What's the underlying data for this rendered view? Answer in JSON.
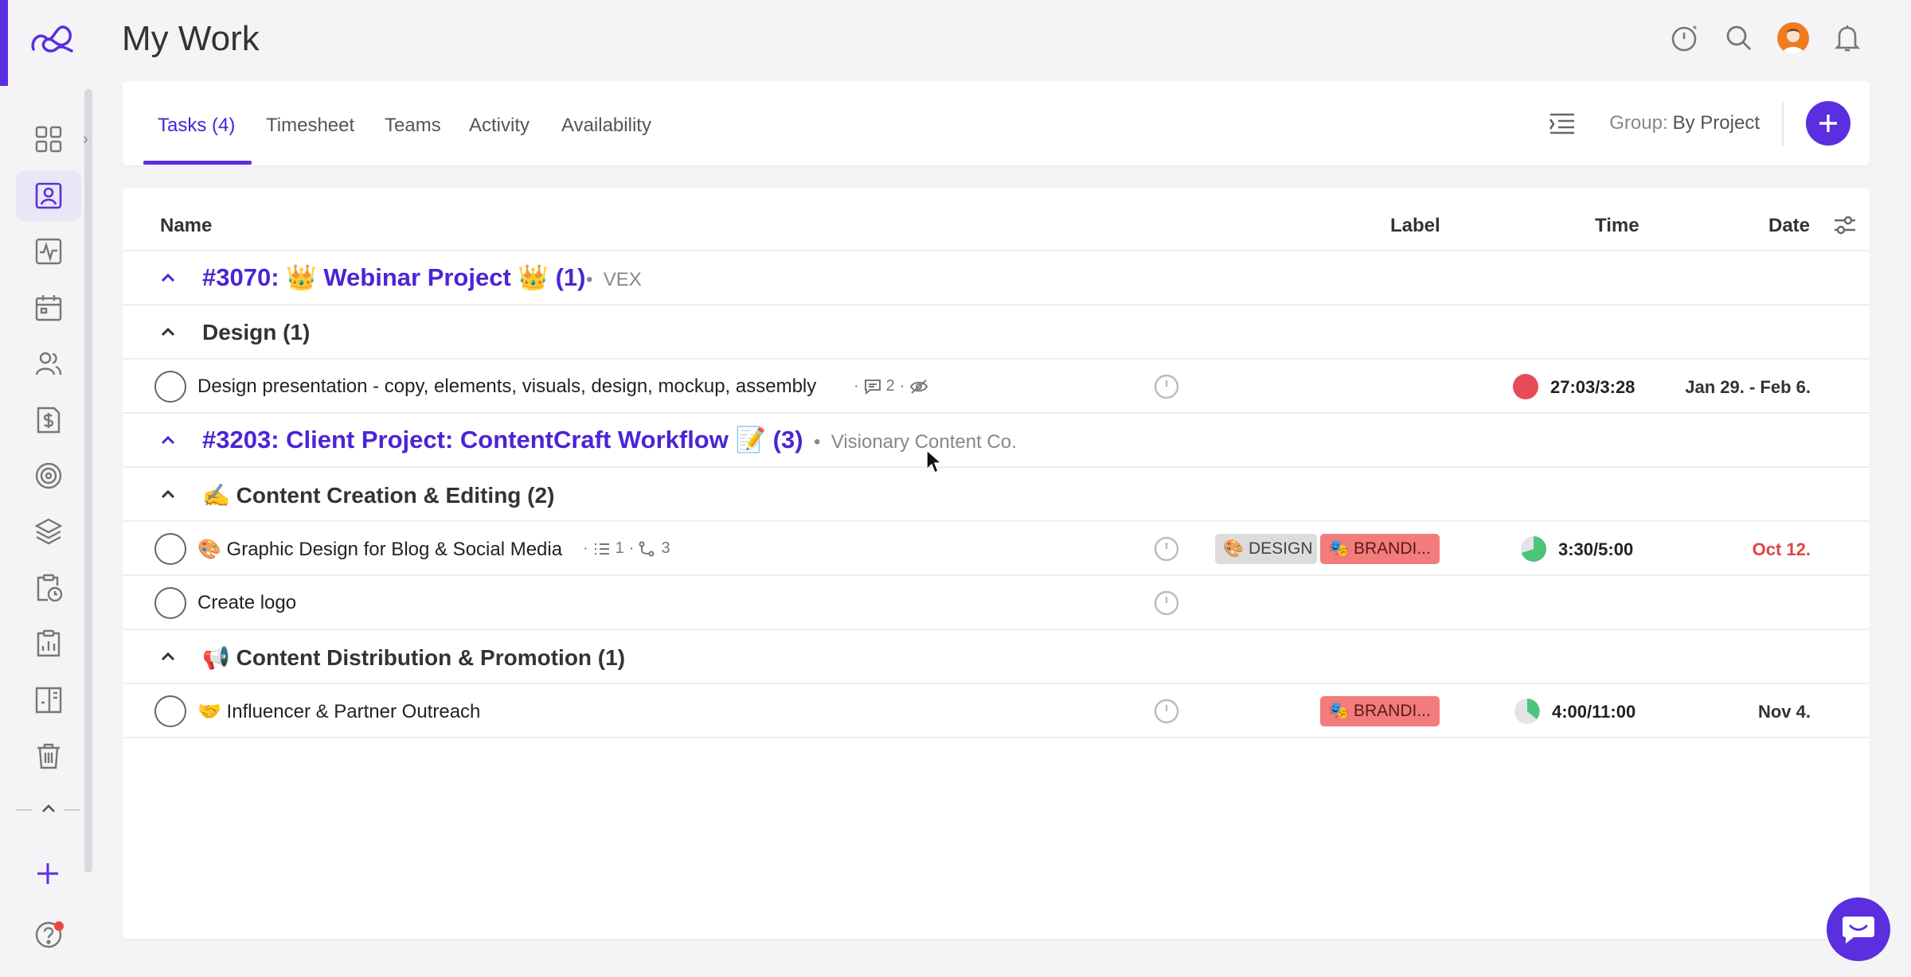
{
  "app": {
    "page_title": "My Work",
    "accent_color": "#5b2ee0"
  },
  "sidebar": {
    "items": [
      {
        "icon": "grid-icon"
      },
      {
        "icon": "user-card-icon",
        "active": true
      },
      {
        "icon": "activity-pulse-icon"
      },
      {
        "icon": "calendar-icon"
      },
      {
        "icon": "team-users-icon"
      },
      {
        "icon": "dollar-invoice-icon"
      },
      {
        "icon": "target-goal-icon"
      },
      {
        "icon": "layers-icon"
      },
      {
        "icon": "clipboard-clock-icon"
      },
      {
        "icon": "clipboard-chart-icon"
      },
      {
        "icon": "kanban-board-icon"
      },
      {
        "icon": "trash-icon"
      }
    ]
  },
  "tabs": {
    "items": [
      {
        "label": "Tasks (4)",
        "active": true
      },
      {
        "label": "Timesheet"
      },
      {
        "label": "Teams"
      },
      {
        "label": "Activity"
      },
      {
        "label": "Availability"
      }
    ],
    "group_label": "Group:",
    "group_value": "By Project"
  },
  "table": {
    "headers": {
      "name": "Name",
      "label": "Label",
      "time": "Time",
      "date": "Date"
    },
    "projects": [
      {
        "title": "#3070: 👑 Webinar Project 👑 (1)",
        "client": "VEX",
        "sections": [
          {
            "title": "Design (1)",
            "tasks": [
              {
                "name": "Design presentation - copy, elements, visuals, design, mockup, assembly",
                "comments": "2",
                "labels": [],
                "time": "27:03/3:28",
                "time_status": "over",
                "date": "Jan 29. - Feb 6."
              }
            ]
          }
        ]
      },
      {
        "title": "#3203: Client Project: ContentCraft Workflow 📝 (3)",
        "client": "Visionary Content Co.",
        "sections": [
          {
            "title": "✍️ Content Creation & Editing (2)",
            "tasks": [
              {
                "name": "🎨 Graphic Design for Blog & Social Media",
                "checklist": "1",
                "subtasks": "3",
                "labels": [
                  {
                    "text": "🎨 DESIGN",
                    "color": "#dcdcdc"
                  },
                  {
                    "text": "🎭 BRANDI...",
                    "color": "#f27b7b"
                  }
                ],
                "time": "3:30/5:00",
                "time_progress": 0.7,
                "date": "Oct 12.",
                "date_overdue": true
              },
              {
                "name": "Create logo",
                "labels": [],
                "time": "",
                "date": ""
              }
            ]
          },
          {
            "title": "📢 Content Distribution & Promotion (1)",
            "tasks": [
              {
                "name": "🤝 Influencer & Partner Outreach",
                "labels": [
                  {
                    "text": "🎭 BRANDI...",
                    "color": "#f27b7b"
                  }
                ],
                "time": "4:00/11:00",
                "time_progress": 0.36,
                "date": "Nov 4."
              }
            ]
          }
        ]
      }
    ]
  }
}
